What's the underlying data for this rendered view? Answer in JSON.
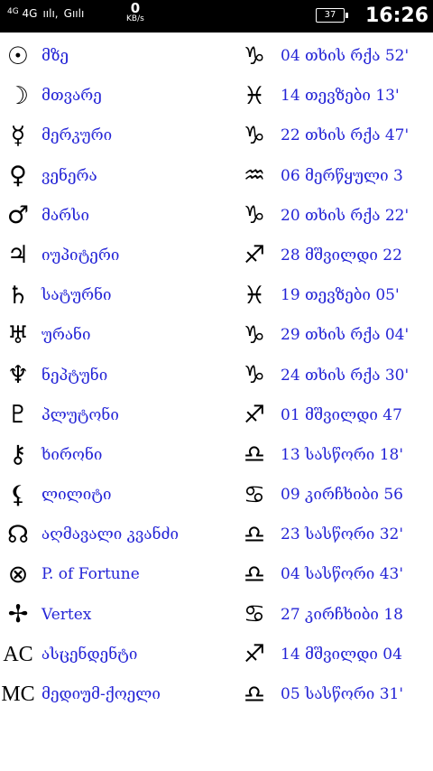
{
  "status_bar": {
    "network1": "4G",
    "network2": "4G",
    "signal_text": "G",
    "speed_value": "0",
    "speed_unit": "KB/s",
    "battery": "37",
    "time": "16:26"
  },
  "rows": [
    {
      "planet_icon": "sun-icon",
      "planet_glyph": "☉",
      "planet": "მზე",
      "sign_icon": "capricorn-icon",
      "sign_glyph": "♑",
      "position": "04 თხის რქა 52'"
    },
    {
      "planet_icon": "moon-icon",
      "planet_glyph": "☽",
      "planet": "მთვარე",
      "sign_icon": "pisces-icon",
      "sign_glyph": "♓",
      "position": "14 თევზები 13'"
    },
    {
      "planet_icon": "mercury-icon",
      "planet_glyph": "☿",
      "planet": "მერკური",
      "sign_icon": "capricorn-icon",
      "sign_glyph": "♑",
      "position": "22 თხის რქა 47'"
    },
    {
      "planet_icon": "venus-icon",
      "planet_glyph": "♀",
      "planet": "ვენერა",
      "sign_icon": "aquarius-icon",
      "sign_glyph": "♒",
      "position": "06 მერწყული 3"
    },
    {
      "planet_icon": "mars-icon",
      "planet_glyph": "♂",
      "planet": "მარსი",
      "sign_icon": "capricorn-icon",
      "sign_glyph": "♑",
      "position": "20 თხის რქა 22'"
    },
    {
      "planet_icon": "jupiter-icon",
      "planet_glyph": "♃",
      "planet": "იუპიტერი",
      "sign_icon": "sagittarius-icon",
      "sign_glyph": "♐",
      "position": "28 მშვილდი 22"
    },
    {
      "planet_icon": "saturn-icon",
      "planet_glyph": "♄",
      "planet": "სატურნი",
      "sign_icon": "pisces-icon",
      "sign_glyph": "♓",
      "position": "19 თევზები 05'"
    },
    {
      "planet_icon": "uranus-icon",
      "planet_glyph": "♅",
      "planet": "ურანი",
      "sign_icon": "capricorn-icon",
      "sign_glyph": "♑",
      "position": "29 თხის რქა 04'"
    },
    {
      "planet_icon": "neptune-icon",
      "planet_glyph": "♆",
      "planet": "ნეპტუნი",
      "sign_icon": "capricorn-icon",
      "sign_glyph": "♑",
      "position": "24 თხის რქა 30'"
    },
    {
      "planet_icon": "pluto-icon",
      "planet_glyph": "♇",
      "planet": "პლუტონი",
      "sign_icon": "sagittarius-icon",
      "sign_glyph": "♐",
      "position": "01 მშვილდი 47"
    },
    {
      "planet_icon": "chiron-icon",
      "planet_glyph": "⚷",
      "planet": "ხირონი",
      "sign_icon": "libra-icon",
      "sign_glyph": "♎",
      "position": "13 სასწორი 18'"
    },
    {
      "planet_icon": "lilith-icon",
      "planet_glyph": "⚸",
      "planet": "ლილიტი",
      "sign_icon": "cancer-icon",
      "sign_glyph": "♋",
      "position": "09 კირჩხიბი 56"
    },
    {
      "planet_icon": "north-node-icon",
      "planet_glyph": "☊",
      "planet": "აღმავალი კვანძი",
      "sign_icon": "libra-icon",
      "sign_glyph": "♎",
      "position": "23 სასწორი 32'"
    },
    {
      "planet_icon": "part-of-fortune-icon",
      "planet_glyph": "⊗",
      "planet": "P. of Fortune",
      "sign_icon": "libra-icon",
      "sign_glyph": "♎",
      "position": "04 სასწორი 43'"
    },
    {
      "planet_icon": "vertex-icon",
      "planet_glyph": "✢",
      "planet": "Vertex",
      "sign_icon": "cancer-icon",
      "sign_glyph": "♋",
      "position": "27 კირჩხიბი 18"
    },
    {
      "planet_icon": "ascendant-icon",
      "planet_glyph": "AC",
      "planet": "ასცენდენტი",
      "sign_icon": "sagittarius-icon",
      "sign_glyph": "♐",
      "position": "14 მშვილდი 04"
    },
    {
      "planet_icon": "midheaven-icon",
      "planet_glyph": "MC",
      "planet": "მედიუმ-ქოელი",
      "sign_icon": "libra-icon",
      "sign_glyph": "♎",
      "position": "05 სასწორი 31'"
    }
  ]
}
